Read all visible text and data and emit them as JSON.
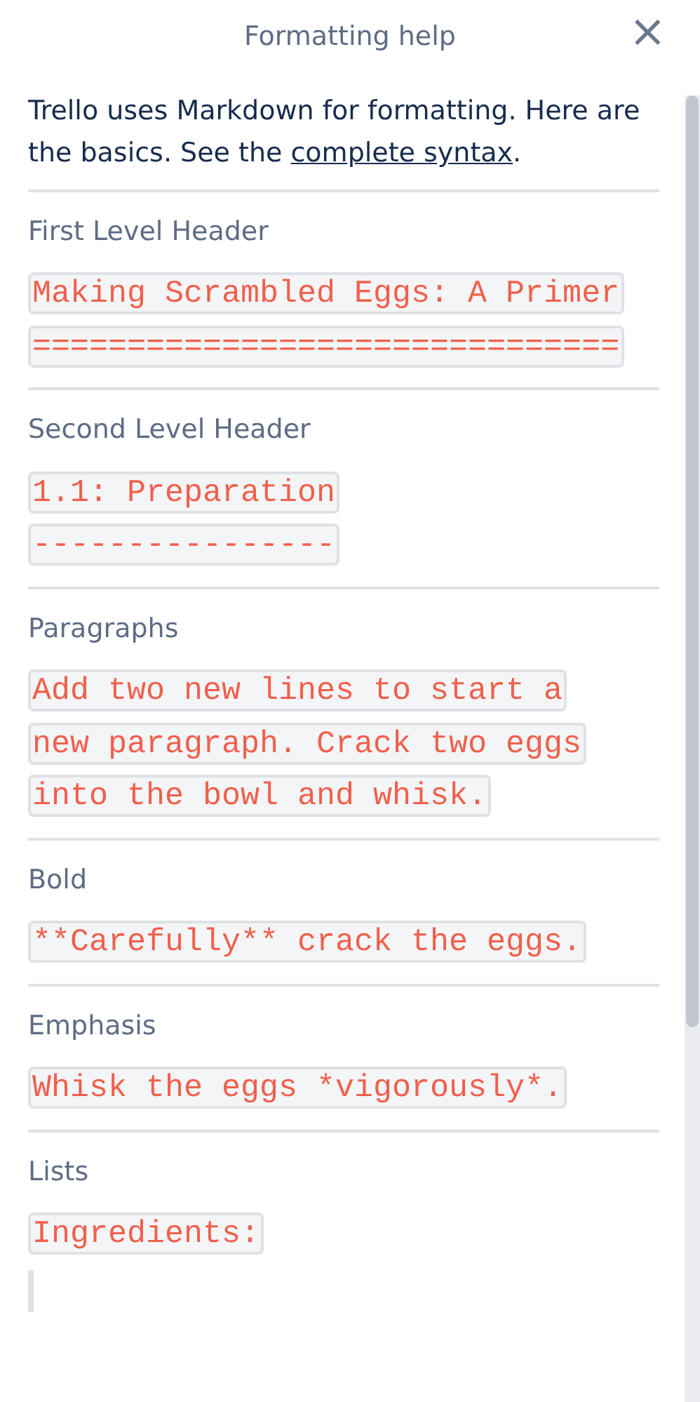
{
  "header": {
    "title": "Formatting help",
    "close": "×"
  },
  "intro": {
    "text": "Trello uses Markdown for formatting. Here are the basics. See the ",
    "link": "complete syntax",
    "end": "."
  },
  "sections": [
    {
      "title": "First Level Header",
      "code": [
        {
          "kind": "code",
          "text": "Making Scrambled Eggs: A Primer"
        },
        {
          "kind": "code",
          "text": "==============================="
        }
      ]
    },
    {
      "title": "Second Level Header",
      "code": [
        {
          "kind": "code",
          "text": "1.1: Preparation"
        },
        {
          "kind": "code",
          "text": "----------------"
        }
      ]
    },
    {
      "title": "Paragraphs",
      "code": [
        {
          "kind": "code",
          "text": "Add two new lines to start a"
        },
        {
          "kind": "code",
          "text": "new paragraph. Crack two eggs"
        },
        {
          "kind": "code",
          "text": "into the bowl and whisk."
        }
      ]
    },
    {
      "title": "Bold",
      "code": [
        {
          "kind": "code",
          "text": "**Carefully** crack the eggs."
        }
      ]
    },
    {
      "title": "Emphasis",
      "code": [
        {
          "kind": "code",
          "text": "Whisk the eggs *vigorously*."
        }
      ]
    },
    {
      "title": "Lists",
      "code": [
        {
          "kind": "code",
          "text": "Ingredients:"
        },
        {
          "kind": "blank"
        }
      ]
    }
  ]
}
